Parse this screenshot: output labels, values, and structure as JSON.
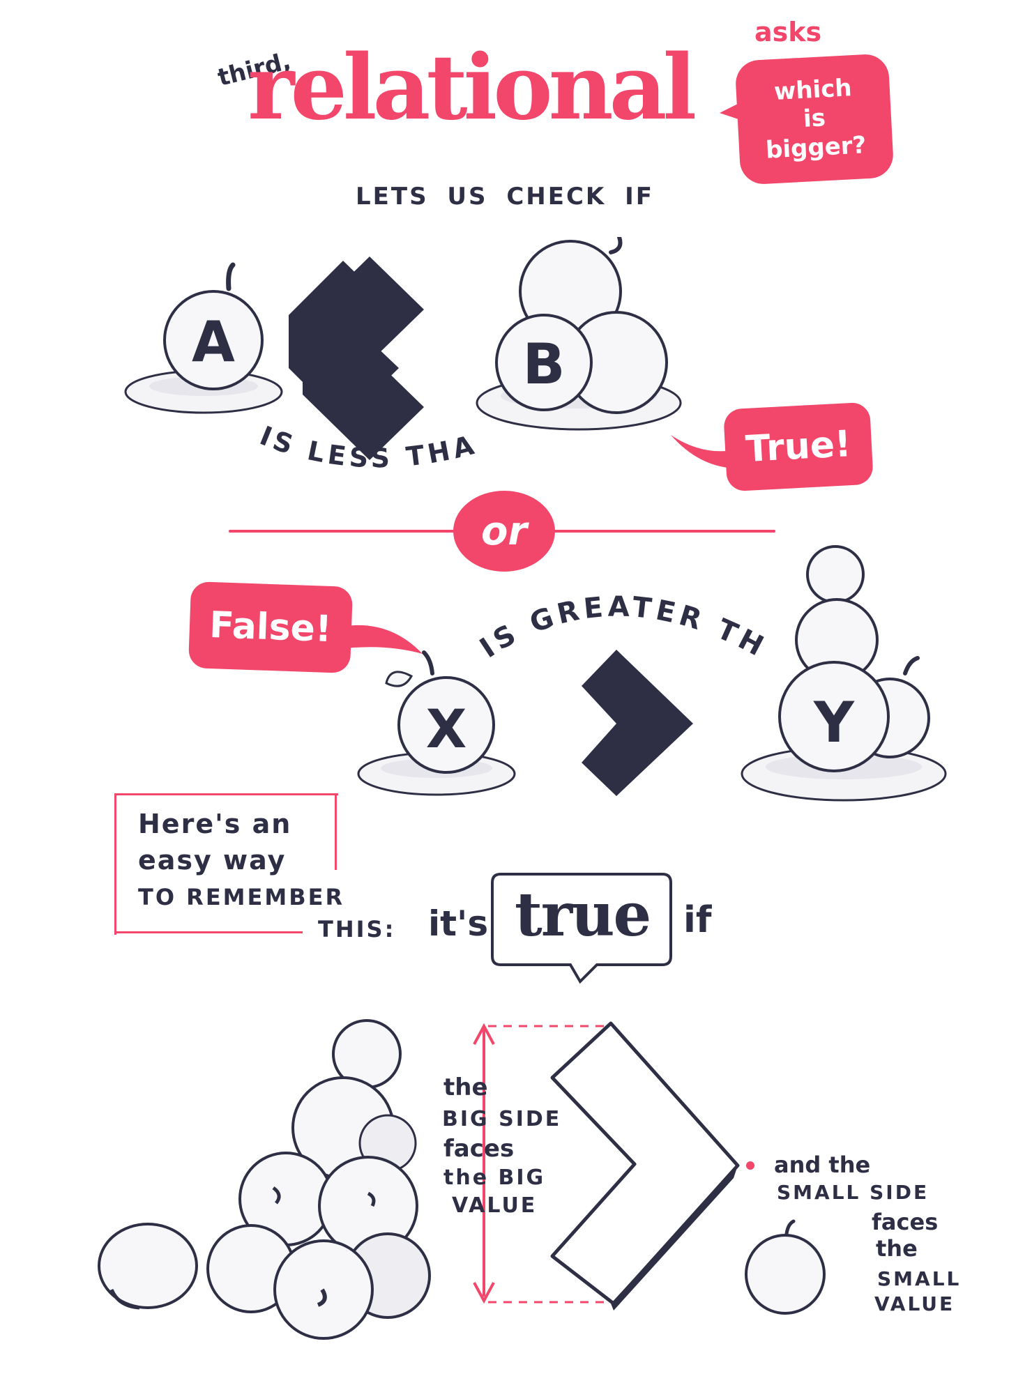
{
  "header": {
    "prefix": "third,",
    "title": "relational",
    "asks": "asks",
    "question_lines": [
      "which",
      "is",
      "bigger?"
    ],
    "subtitle": "LETS US CHECK IF"
  },
  "less_than": {
    "left_label": "A",
    "right_label": "B",
    "operator_text": "IS LESS THAN",
    "result": "True!"
  },
  "divider": {
    "label": "or"
  },
  "greater_than": {
    "result": "False!",
    "left_label": "X",
    "right_label": "Y",
    "operator_text": "IS GREATER THAN"
  },
  "tip": {
    "box_lines": [
      "Here's an",
      "easy way",
      "TO REMEMBER"
    ],
    "this_label": "THIS:",
    "its": "it's",
    "true_word": "true",
    "if_word": "if"
  },
  "explanation": {
    "big_side_lines": [
      "the",
      "BIG SIDE",
      "faces",
      "the BIG",
      "VALUE"
    ],
    "small_side_lines": [
      "and the",
      "SMALL SIDE",
      "faces",
      "the",
      "SMALL",
      "VALUE"
    ]
  },
  "colors": {
    "accent": "#f2476b",
    "ink": "#2e2f45",
    "plate": "#f4f4f6",
    "fruit": "#f7f7f9"
  }
}
